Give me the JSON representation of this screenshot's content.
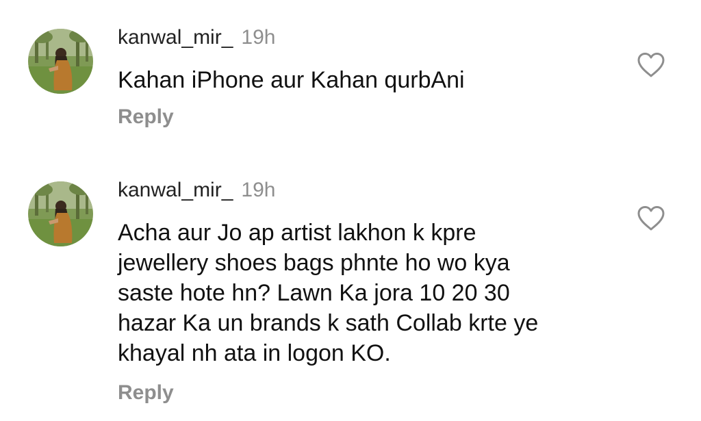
{
  "comments": [
    {
      "username": "kanwal_mir_",
      "time": "19h",
      "text": "Kahan iPhone aur Kahan qurbAni",
      "reply_label": "Reply",
      "avatar_icon": "avatar-woman-in-field",
      "like_icon": "heart-outline-icon"
    },
    {
      "username": "kanwal_mir_",
      "time": "19h",
      "text_lines": [
        "Acha aur Jo ap artist lakhon k kpre",
        "jewellery shoes bags phnte ho wo kya",
        "saste hote hn? Lawn Ka jora 10 20 30",
        "hazar Ka un brands k sath Collab krte ye",
        "khayal nh ata in logon KO."
      ],
      "reply_label": "Reply",
      "avatar_icon": "avatar-woman-in-field",
      "like_icon": "heart-outline-icon"
    }
  ],
  "colors": {
    "text": "#111111",
    "muted": "#8e8e8e",
    "background": "#ffffff"
  }
}
